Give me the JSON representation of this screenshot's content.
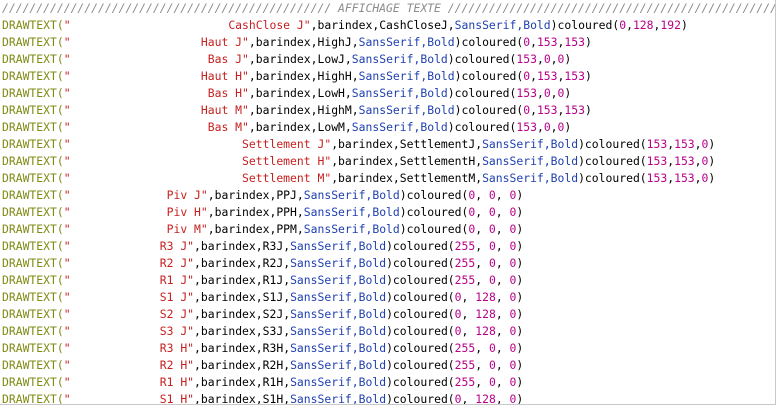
{
  "editor": {
    "colors": {
      "background": "#ffffff",
      "keyword": "#7f8a12",
      "string": "#c61f1f",
      "font_keyword": "#1f3fb0",
      "number": "#b8008a",
      "comment": "#8c8c8c"
    },
    "comment_line": "//////////////////////////////////////////////// AFFICHAGE TEXTE //////////////////////////////////////////////////",
    "lines": [
      {
        "kw": "DRAWTEXT(",
        "str": "\"                       CashClose J\"",
        "rest": ",barindex,CashCloseJ,",
        "font": "SansSerif,Bold",
        "col": ")coloured(",
        "n1": "0",
        "n2": "128",
        "n3": "192",
        "end": ")"
      },
      {
        "kw": "DRAWTEXT(",
        "str": "\"                   Haut J\"",
        "rest": ",barindex,HighJ,",
        "font": "SansSerif,Bold",
        "col": ")coloured(",
        "n1": "0",
        "n2": "153",
        "n3": "153",
        "end": ")"
      },
      {
        "kw": "DRAWTEXT(",
        "str": "\"                    Bas J\"",
        "rest": ",barindex,LowJ,",
        "font": "SansSerif,Bold",
        "col": ")coloured(",
        "n1": "153",
        "n2": "0",
        "n3": "0",
        "end": ")"
      },
      {
        "kw": "DRAWTEXT(",
        "str": "\"                   Haut H\"",
        "rest": ",barindex,HighH,",
        "font": "SansSerif,Bold",
        "col": ")coloured(",
        "n1": "0",
        "n2": "153",
        "n3": "153",
        "end": ")"
      },
      {
        "kw": "DRAWTEXT(",
        "str": "\"                    Bas H\"",
        "rest": ",barindex,LowH,",
        "font": "SansSerif,Bold",
        "col": ")coloured(",
        "n1": "153",
        "n2": "0",
        "n3": "0",
        "end": ")"
      },
      {
        "kw": "DRAWTEXT(",
        "str": "\"                   Haut M\"",
        "rest": ",barindex,HighM,",
        "font": "SansSerif,Bold",
        "col": ")coloured(",
        "n1": "0",
        "n2": "153",
        "n3": "153",
        "end": ")"
      },
      {
        "kw": "DRAWTEXT(",
        "str": "\"                    Bas M\"",
        "rest": ",barindex,LowM,",
        "font": "SansSerif,Bold",
        "col": ")coloured(",
        "n1": "153",
        "n2": "0",
        "n3": "0",
        "end": ")"
      },
      {
        "kw": "DRAWTEXT(",
        "str": "\"                         Settlement J\"",
        "rest": ",barindex,SettlementJ,",
        "font": "SansSerif,Bold",
        "col": ")coloured(",
        "n1": "153",
        "n2": "153",
        "n3": "0",
        "end": ")"
      },
      {
        "kw": "DRAWTEXT(",
        "str": "\"                         Settlement H\"",
        "rest": ",barindex,SettlementH,",
        "font": "SansSerif,Bold",
        "col": ")coloured(",
        "n1": "153",
        "n2": "153",
        "n3": "0",
        "end": ")"
      },
      {
        "kw": "DRAWTEXT(",
        "str": "\"                         Settlement M\"",
        "rest": ",barindex,SettlementM,",
        "font": "SansSerif,Bold",
        "col": ")coloured(",
        "n1": "153",
        "n2": "153",
        "n3": "0",
        "end": ")"
      },
      {
        "kw": "DRAWTEXT(",
        "str": "\"              Piv J\"",
        "rest": ",barindex,PPJ,",
        "font": "SansSerif,Bold",
        "col": ")coloured(",
        "n1": "0",
        "n2": " 0",
        "n3": " 0",
        "end": ")"
      },
      {
        "kw": "DRAWTEXT(",
        "str": "\"              Piv H\"",
        "rest": ",barindex,PPH,",
        "font": "SansSerif,Bold",
        "col": ")coloured(",
        "n1": "0",
        "n2": " 0",
        "n3": " 0",
        "end": ")"
      },
      {
        "kw": "DRAWTEXT(",
        "str": "\"              Piv M\"",
        "rest": ",barindex,PPM,",
        "font": "SansSerif,Bold",
        "col": ")coloured(",
        "n1": "0",
        "n2": " 0",
        "n3": " 0",
        "end": ")"
      },
      {
        "kw": "DRAWTEXT(",
        "str": "\"             R3 J\"",
        "rest": ",barindex,R3J,",
        "font": "SansSerif,Bold",
        "col": ")coloured(",
        "n1": "255",
        "n2": " 0",
        "n3": " 0",
        "end": ")"
      },
      {
        "kw": "DRAWTEXT(",
        "str": "\"             R2 J\"",
        "rest": ",barindex,R2J,",
        "font": "SansSerif,Bold",
        "col": ")coloured(",
        "n1": "255",
        "n2": " 0",
        "n3": " 0",
        "end": ")"
      },
      {
        "kw": "DRAWTEXT(",
        "str": "\"             R1 J\"",
        "rest": ",barindex,R1J,",
        "font": "SansSerif,Bold",
        "col": ")coloured(",
        "n1": "255",
        "n2": " 0",
        "n3": " 0",
        "end": ")"
      },
      {
        "kw": "DRAWTEXT(",
        "str": "\"             S1 J\"",
        "rest": ",barindex,S1J,",
        "font": "SansSerif,Bold",
        "col": ")coloured(",
        "n1": "0",
        "n2": " 128",
        "n3": " 0",
        "end": ")"
      },
      {
        "kw": "DRAWTEXT(",
        "str": "\"             S2 J\"",
        "rest": ",barindex,S2J,",
        "font": "SansSerif,Bold",
        "col": ")coloured(",
        "n1": "0",
        "n2": " 128",
        "n3": " 0",
        "end": ")"
      },
      {
        "kw": "DRAWTEXT(",
        "str": "\"             S3 J\"",
        "rest": ",barindex,S3J,",
        "font": "SansSerif,Bold",
        "col": ")coloured(",
        "n1": "0",
        "n2": " 128",
        "n3": " 0",
        "end": ")"
      },
      {
        "kw": "DRAWTEXT(",
        "str": "\"             R3 H\"",
        "rest": ",barindex,R3H,",
        "font": "SansSerif,Bold",
        "col": ")coloured(",
        "n1": "255",
        "n2": " 0",
        "n3": " 0",
        "end": ")"
      },
      {
        "kw": "DRAWTEXT(",
        "str": "\"             R2 H\"",
        "rest": ",barindex,R2H,",
        "font": "SansSerif,Bold",
        "col": ")coloured(",
        "n1": "255",
        "n2": " 0",
        "n3": " 0",
        "end": ")"
      },
      {
        "kw": "DRAWTEXT(",
        "str": "\"             R1 H\"",
        "rest": ",barindex,R1H,",
        "font": "SansSerif,Bold",
        "col": ")coloured(",
        "n1": "255",
        "n2": " 0",
        "n3": " 0",
        "end": ")"
      },
      {
        "kw": "DRAWTEXT(",
        "str": "\"             S1 H\"",
        "rest": ",barindex,S1H,",
        "font": "SansSerif,Bold",
        "col": ")coloured(",
        "n1": "0",
        "n2": " 128",
        "n3": " 0",
        "end": ")"
      }
    ]
  }
}
